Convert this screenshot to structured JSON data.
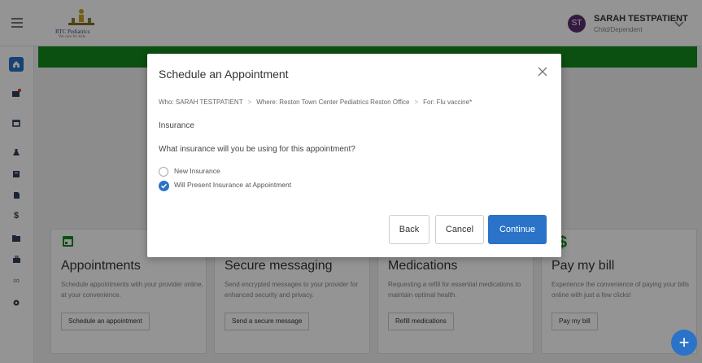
{
  "header": {
    "logo_name": "RTC Pediatrics",
    "logo_tagline": "We care for kids",
    "user": {
      "initials": "ST",
      "name": "SARAH TESTPATIENT",
      "role": "Child/Dependent"
    }
  },
  "sidebar": {
    "items": [
      {
        "icon": "home-icon",
        "active": true
      },
      {
        "icon": "messages-icon",
        "badge": true
      },
      {
        "icon": "calendar-icon"
      },
      {
        "icon": "lab-flask-icon"
      },
      {
        "icon": "clipboard-icon"
      },
      {
        "icon": "document-icon"
      },
      {
        "icon": "dollar-icon"
      },
      {
        "icon": "folder-icon"
      },
      {
        "icon": "medical-bag-icon"
      },
      {
        "icon": "link-icon"
      },
      {
        "icon": "gear-icon"
      }
    ]
  },
  "tiles": [
    {
      "title": "Appointments",
      "description": "Schedule appointments with your provider online, at your convenience.",
      "button": "Schedule an appointment"
    },
    {
      "title": "Secure messaging",
      "description": "Send encrypted messages to your provider for enhanced security and privacy.",
      "button": "Send a secure message"
    },
    {
      "title": "Medications",
      "description": "Requesting a refill for essential medications to maintain optimal health.",
      "button": "Refill medications"
    },
    {
      "title": "Pay my bill",
      "description": "Experience the convenience of paying your bills online with just a few clicks!",
      "button": "Pay my bill"
    }
  ],
  "modal": {
    "title": "Schedule an Appointment",
    "breadcrumb": {
      "who": "Who: SARAH TESTPATIENT",
      "where": "Where: Reston Town Center Pediatrics Reston Office",
      "for": "For: Flu vaccine*",
      "separator": ">"
    },
    "section": "Insurance",
    "question": "What insurance will you be using for this appointment?",
    "options": [
      {
        "label": "New Insurance",
        "selected": false
      },
      {
        "label": "Will Present Insurance at Appointment",
        "selected": true
      }
    ],
    "buttons": {
      "back": "Back",
      "cancel": "Cancel",
      "continue": "Continue"
    }
  },
  "fab_symbol": "+",
  "colors": {
    "accent": "#2a73c8",
    "brand_green": "#138a1e",
    "avatar": "#5a2d6e"
  }
}
